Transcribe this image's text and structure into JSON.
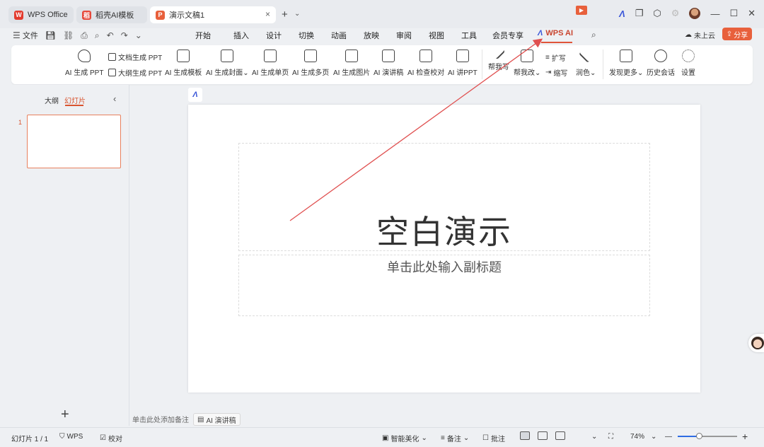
{
  "titlebar": {
    "tabs": [
      {
        "label": "WPS Office",
        "logo": "W",
        "logo_color": "#e33b2e"
      },
      {
        "label": "稻壳AI模板",
        "logo": "稻",
        "logo_color": "#e6493b"
      },
      {
        "label": "演示文稿1",
        "logo": "P",
        "logo_color": "#e8603c"
      }
    ],
    "close_tab_glyph": "×",
    "new_tab_glyph": "+",
    "new_tab_dropdown_glyph": "⌄",
    "window_controls": {
      "minimize": "—",
      "maximize": "☐",
      "close": "✕"
    }
  },
  "menubar": {
    "file_label": "文件",
    "tabs": [
      "开始",
      "插入",
      "设计",
      "切换",
      "动画",
      "放映",
      "审阅",
      "视图",
      "工具",
      "会员专享"
    ],
    "ai_tab_label": "WPS AI",
    "ai_tab_icon": "Λ",
    "cloud_label": "未上云",
    "share_label": "分享"
  },
  "ribbon": {
    "ai_ppt": "AI 生成 PPT",
    "doc_gen_ppt": "文档生成 PPT",
    "outline_gen_ppt": "大纲生成 PPT",
    "ai_template": "AI 生成模板",
    "ai_cover": "AI 生成封面",
    "ai_single": "AI 生成单页",
    "ai_multi": "AI 生成多页",
    "ai_image": "AI 生成图片",
    "ai_speech": "AI 演讲稿",
    "ai_check": "AI 检查校对",
    "ai_talk": "AI 讲PPT",
    "help_write": "帮我写",
    "help_edit": "帮我改",
    "expand": "扩写",
    "shrink": "缩写",
    "polish": "润色",
    "discover_more": "发现更多",
    "history": "历史会话",
    "settings": "设置"
  },
  "leftpanel": {
    "tab_outline": "大纲",
    "tab_slides": "幻灯片",
    "collapse_glyph": "‹",
    "slide_number": "1",
    "add_glyph": "+"
  },
  "canvas": {
    "ai_logo_glyph": "Λ",
    "title": "空白演示",
    "subtitle": "单击此处输入副标题",
    "notes_placeholder": "单击此处添加备注",
    "ai_notes_label": "AI 演讲稿"
  },
  "statusbar": {
    "slide_counter": "幻灯片 1 / 1",
    "theme": "WPS",
    "proofread": "校对",
    "smart_beautify": "智能美化",
    "notes": "备注",
    "comments": "批注",
    "zoom": "74%",
    "zoom_level": 0.74
  },
  "colors": {
    "accent": "#e0553a",
    "ai_blue": "#3a56d8",
    "arrow": "#e05050"
  }
}
